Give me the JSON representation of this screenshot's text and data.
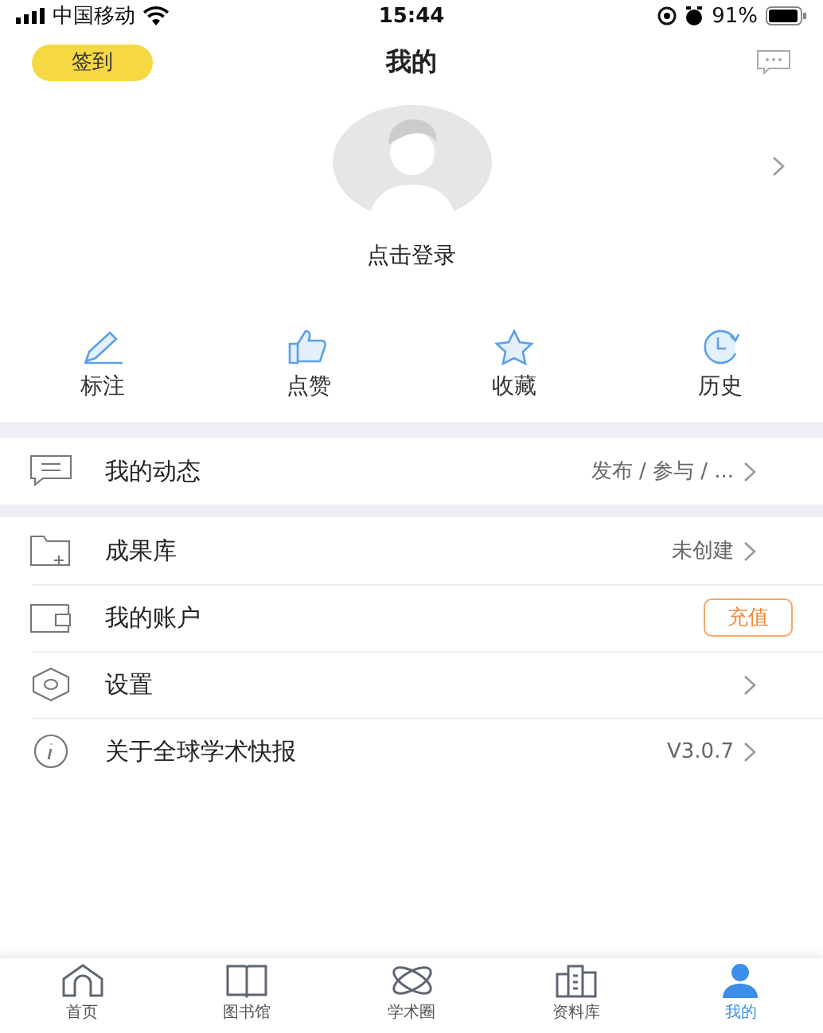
{
  "status_bar": {
    "carrier": "中国移动",
    "time": "15:44",
    "battery": "91%"
  },
  "header": {
    "checkin": "签到",
    "title": "我的"
  },
  "profile": {
    "login": "点击登录"
  },
  "shortcuts": [
    {
      "label": "标注"
    },
    {
      "label": "点赞"
    },
    {
      "label": "收藏"
    },
    {
      "label": "历史"
    }
  ],
  "menu_groups": [
    [
      {
        "label": "我的动态",
        "kind": "link",
        "value": "发布 / 参与 / ..."
      }
    ],
    [
      {
        "label": "成果库",
        "kind": "link",
        "value": "未创建"
      },
      {
        "label": "我的账户",
        "kind": "button",
        "value": "充值"
      },
      {
        "label": "设置",
        "kind": "link"
      },
      {
        "label": "关于全球学术快报",
        "kind": "link",
        "value": "V3.0.7"
      }
    ]
  ],
  "tab_bar": [
    {
      "label": "首页",
      "selected": false
    },
    {
      "label": "图书馆",
      "selected": false
    },
    {
      "label": "学术圈",
      "selected": false
    },
    {
      "label": "资料库",
      "selected": false
    },
    {
      "label": "我的",
      "selected": true
    }
  ]
}
